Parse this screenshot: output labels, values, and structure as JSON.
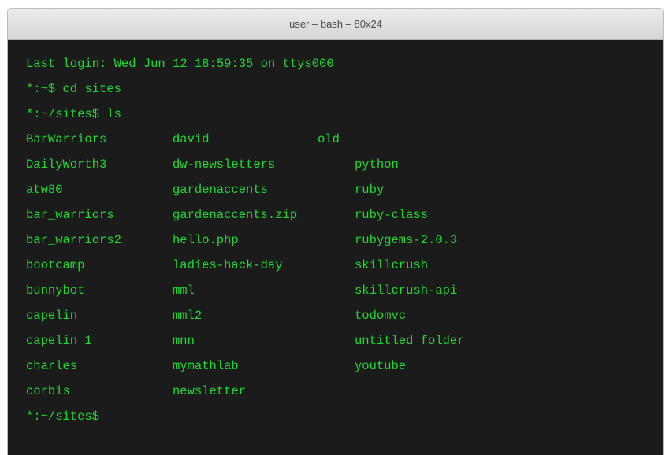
{
  "window": {
    "title": "user – bash – 80x24"
  },
  "terminal": {
    "lines": [
      "Last login: Wed Jun 12 18:59:35 on ttys000",
      "*:~$ cd sites",
      "*:~/sites$ ls"
    ],
    "listing": [
      [
        "BarWarriors",
        "david",
        "old"
      ],
      [
        "DailyWorth3",
        "dw-newsletters",
        "python"
      ],
      [
        "atw80",
        "gardenaccents",
        "ruby"
      ],
      [
        "bar_warriors",
        "gardenaccents.zip",
        "ruby-class"
      ],
      [
        "bar_warriors2",
        "hello.php",
        "rubygems-2.0.3"
      ],
      [
        "bootcamp",
        "ladies-hack-day",
        "skillcrush"
      ],
      [
        "bunnybot",
        "mml",
        "skillcrush-api"
      ],
      [
        "capelin",
        "mml2",
        "todomvc"
      ],
      [
        "capelin 1",
        "mnn",
        "untitled folder"
      ],
      [
        "charles",
        "mymathlab",
        "youtube"
      ],
      [
        "corbis",
        "newsletter",
        ""
      ]
    ],
    "prompt": "*:~/sites$",
    "text_color": "#21d834",
    "background_color": "#1b1b1b"
  }
}
